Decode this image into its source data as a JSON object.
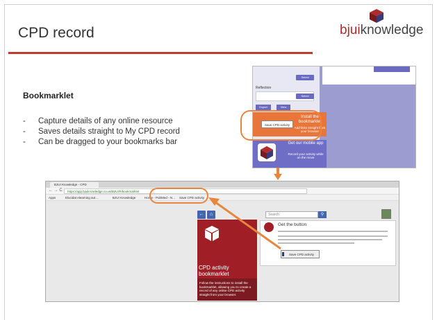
{
  "slide": {
    "title": "CPD record",
    "logo": {
      "brand_bold": "bjui",
      "brand_rest": "knowledge"
    },
    "section_heading": "Bookmarklet",
    "bullets": [
      "Capture details of any online resource",
      "Saves details straight to My CPD record",
      "Can be dragged to your bookmarks bar"
    ],
    "accent_color": "#c0392b",
    "highlight_color": "#e8863e"
  },
  "panel": {
    "select_label": "Select",
    "reflection_label": "Reflection",
    "export_label": "Export",
    "view_label": "View",
    "save_cpd_activity": "Save CPD activity",
    "install_title": "Install the bookmarklet",
    "install_sub": "Add links straight from your browser",
    "app_title": "Get our mobile app",
    "app_sub": "Record your activity while on the move"
  },
  "browser": {
    "tab_title": "BJUI Knowledge - CPD",
    "nav_glyphs": "← → C",
    "url": "https://app.bjuiknowledge.co.uk/BJUI/#/bookmarklet",
    "bookmarks": [
      "Apps",
      "Elucidat elearning aut…",
      "BJUI Knowledge",
      "Home - PubMed - N…",
      "Save CPD activity"
    ],
    "back_icon": "←",
    "home_icon": "⌂",
    "search_placeholder": "Search",
    "search_icon": "🔍",
    "card_title": "CPD activity bookmarklet",
    "card_sub": "Follow the instructions to install the bookmarklet, allowing you to create a record of any online CPD activity straight from your browser.",
    "get_button_title": "Get the button",
    "save_button_label": "Save CPD activity"
  }
}
